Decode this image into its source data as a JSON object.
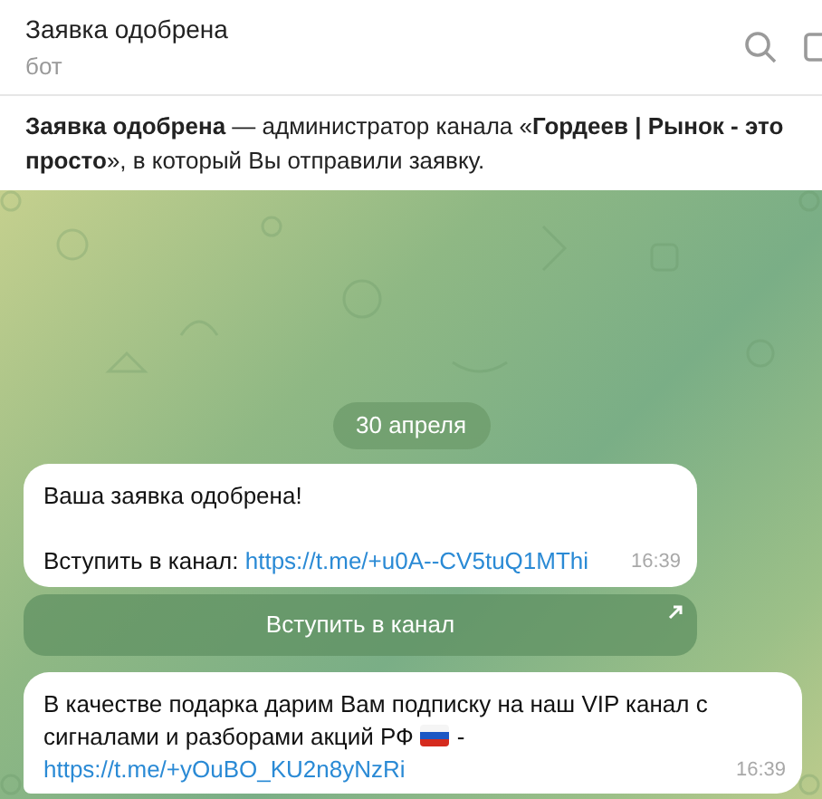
{
  "header": {
    "title": "Заявка одобрена",
    "subtitle": "бот"
  },
  "pinned": {
    "text": "**Заявка одобрена** — администратор канала «**Гордеев | Рынок - это просто**», в который Вы отправили заявку."
  },
  "date_badge": "30 апреля",
  "messages": [
    {
      "lines": [
        "Ваша заявка одобрена!"
      ],
      "label": "Вступить в канал:",
      "link": "https://t.me/+u0A--CV5tuQ1MThi",
      "time": "16:39",
      "button": "Вступить в канал"
    },
    {
      "text": "В качестве подарка дарим Вам подписку на наш VIP канал с сигналами и разборами акций РФ",
      "after_flag": "-",
      "link": "https://t.me/+yOuBO_KU2n8yNzRi",
      "time": "16:39"
    }
  ]
}
